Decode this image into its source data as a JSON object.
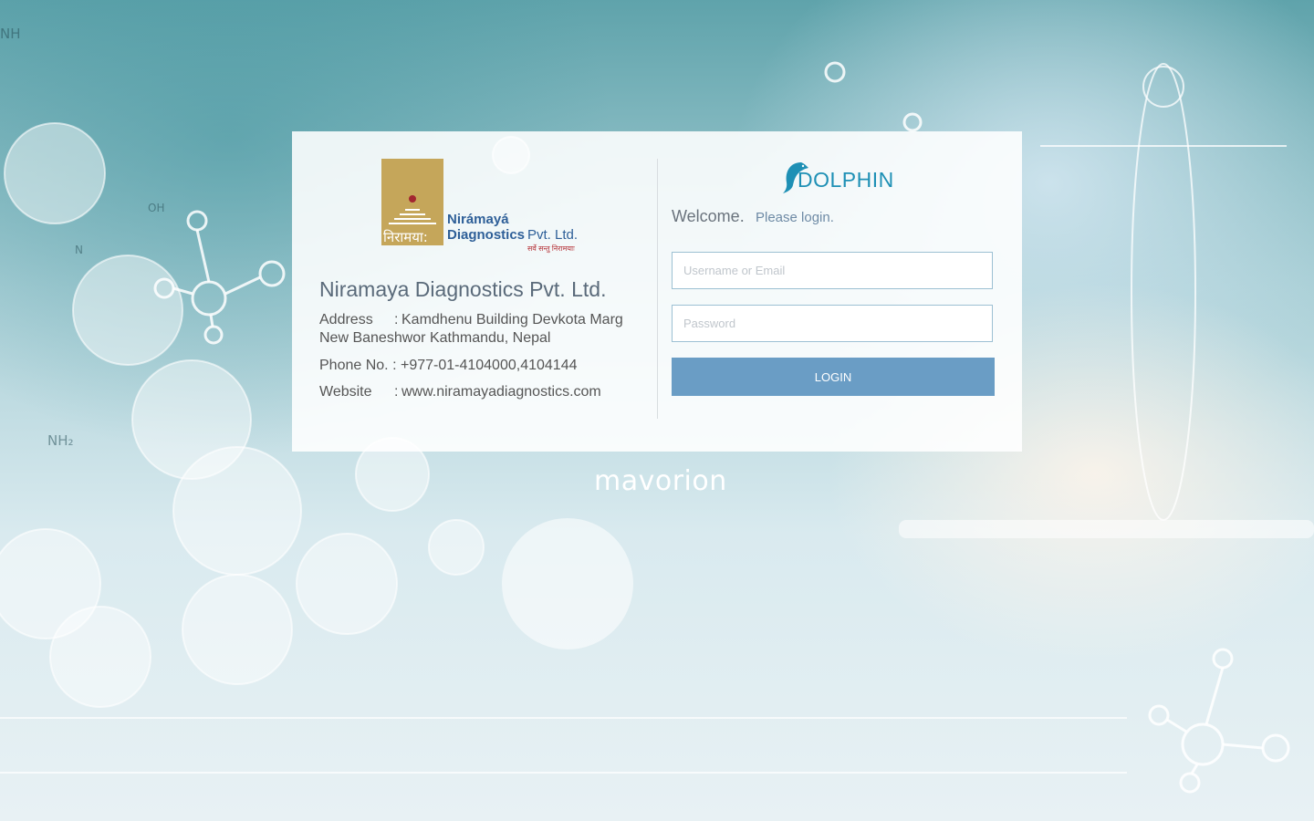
{
  "login_panel": {
    "company_logo": {
      "word1": "Nirámayá",
      "word2": "Diagnostics",
      "suffix": "Pvt. Ltd.",
      "devanagari": "निरामया:",
      "tagline": "सर्वे सन्तु निरामयाः"
    },
    "company_name": "Niramaya Diagnostics Pvt. Ltd.",
    "address": {
      "label": "Address",
      "separator": ":",
      "line1": "Kamdhenu Building Devkota Marg",
      "line2": "New Baneshwor Kathmandu, Nepal"
    },
    "phone": {
      "label": "Phone No.",
      "separator": ":",
      "value": "+977-01-4104000,4104144"
    },
    "website": {
      "label": "Website",
      "separator": ":",
      "value": "www.niramayadiagnostics.com"
    },
    "app_logo": "DOLPHIN",
    "welcome": "Welcome.",
    "please_login": "Please login.",
    "username_placeholder": "Username or Email",
    "password_placeholder": "Password",
    "login_button": "LOGIN"
  },
  "footer_brand": "mavorion",
  "colors": {
    "panel_bg": "#ffffff",
    "button": "#6a9dc5",
    "dolphin_blue": "#1e90b5",
    "niramaya_gold": "#c5a65a",
    "niramaya_blue": "#2e5f98"
  },
  "icons": [
    "dolphin-icon",
    "niramaya-emblem-icon"
  ]
}
